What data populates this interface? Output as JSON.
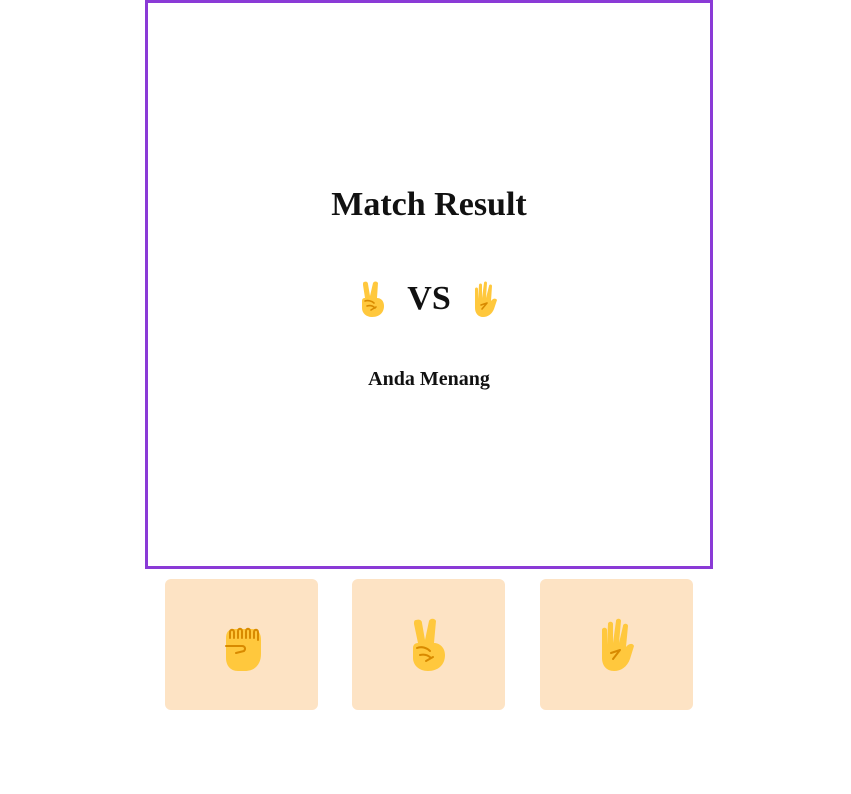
{
  "result_panel": {
    "title": "Match Result",
    "player_choice_icon": "victory-hand-icon",
    "vs_label": "VS",
    "computer_choice_icon": "raised-hand-icon",
    "outcome": "Anda Menang",
    "border_color": "#8a3ad6"
  },
  "choices": [
    {
      "name": "rock",
      "icon": "raised-fist-icon"
    },
    {
      "name": "scissors",
      "icon": "victory-hand-icon"
    },
    {
      "name": "paper",
      "icon": "raised-hand-icon"
    }
  ],
  "colors": {
    "choice_background": "#fde3c4",
    "hand_fill": "#ffc83d",
    "hand_shade": "#d88a00"
  }
}
